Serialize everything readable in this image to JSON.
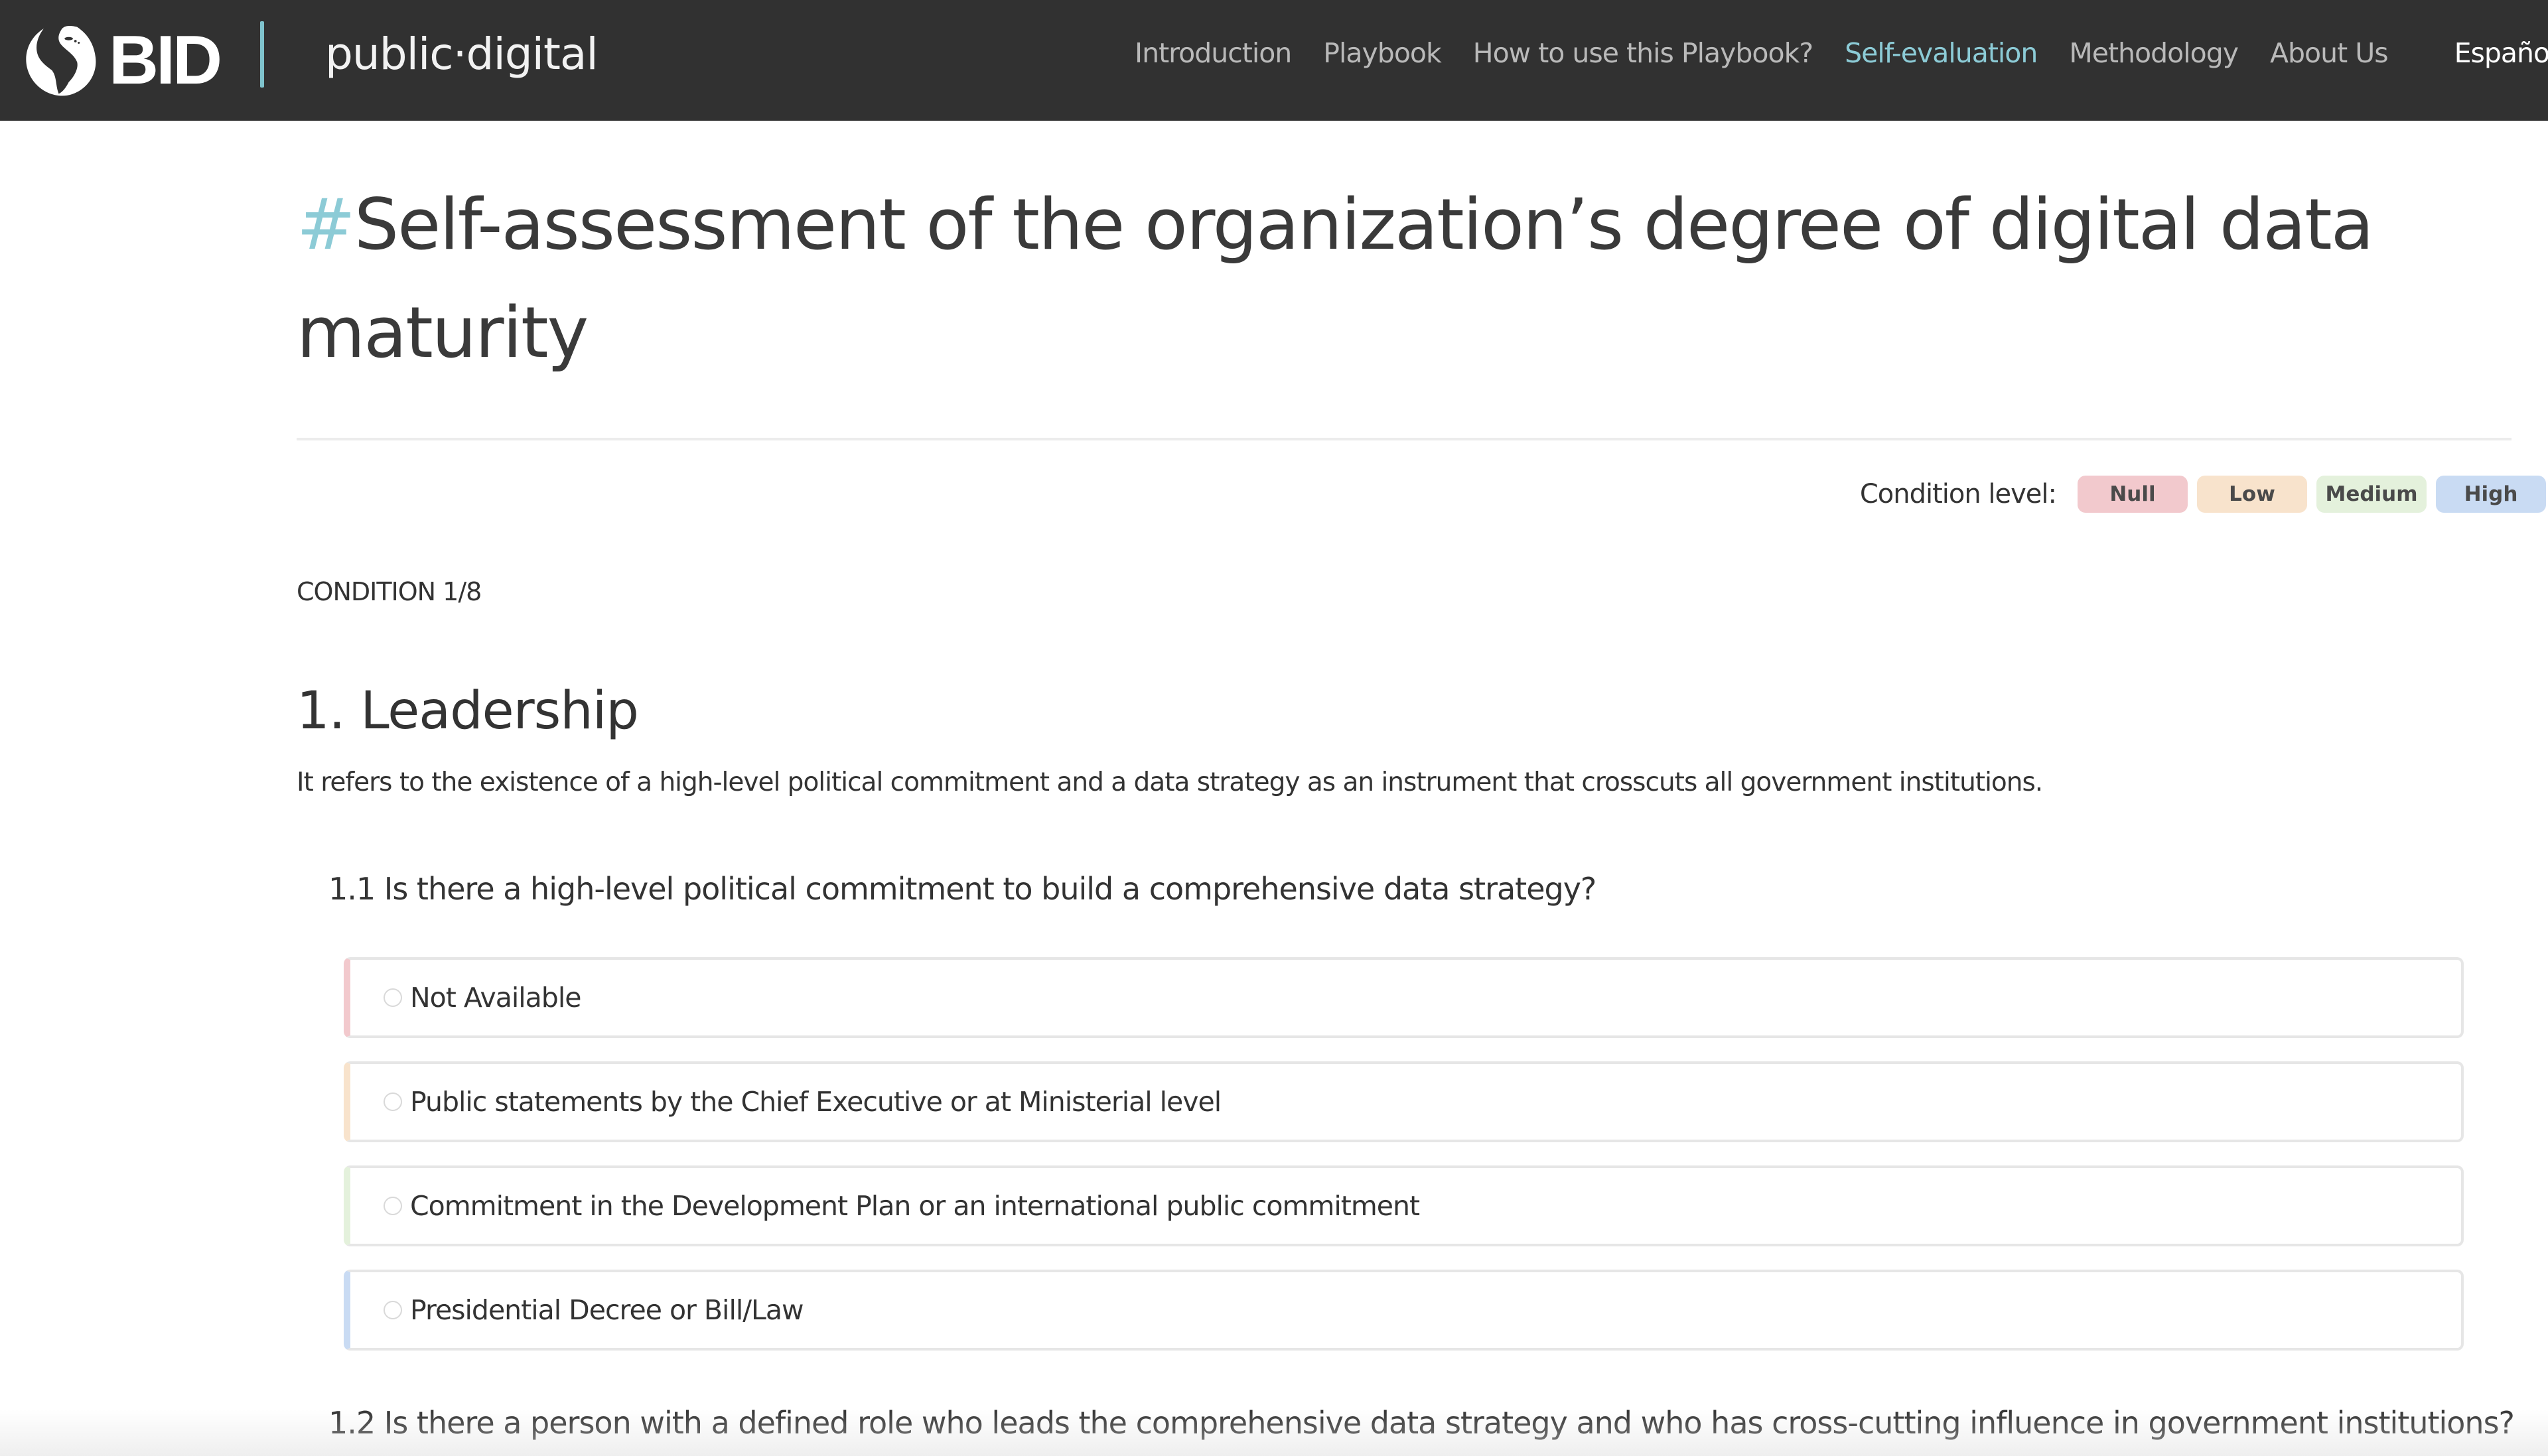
{
  "header": {
    "logo_text": "BID",
    "brand_name": "public·digital",
    "nav": [
      {
        "label": "Introduction",
        "active": false
      },
      {
        "label": "Playbook",
        "active": false
      },
      {
        "label": "How to use this Playbook?",
        "active": false
      },
      {
        "label": "Self-evaluation",
        "active": true
      },
      {
        "label": "Methodology",
        "active": false
      },
      {
        "label": "About Us",
        "active": false
      }
    ],
    "language_label": "Español",
    "colors": {
      "background": "#313131",
      "accent": "#8ccbd6"
    }
  },
  "page": {
    "title_hash": "#",
    "title": "Self-assessment of the organization’s degree of digital data maturity"
  },
  "legend": {
    "label": "Condition level:",
    "levels": [
      {
        "label": "Null",
        "color": "#f2c9cd"
      },
      {
        "label": "Low",
        "color": "#f8e3cc"
      },
      {
        "label": "Medium",
        "color": "#e4f1dc"
      },
      {
        "label": "High",
        "color": "#c9dbf3"
      }
    ]
  },
  "condition": {
    "kicker": "CONDITION 1/8",
    "title": "1. Leadership",
    "description": "It refers to the existence of a high-level political commitment and a data strategy as an instrument that crosscuts all government institutions."
  },
  "questions": [
    {
      "text": "1.1 Is there a high-level political commitment to build a comprehensive data strategy?",
      "options": [
        {
          "label": "Not Available",
          "level": "Null",
          "color": "#f2c9cd",
          "selected": false
        },
        {
          "label": "Public statements by the Chief Executive or at Ministerial level",
          "level": "Low",
          "color": "#f8e3cc",
          "selected": false
        },
        {
          "label": "Commitment in the Development Plan or an international public commitment",
          "level": "Medium",
          "color": "#e4f1dc",
          "selected": false
        },
        {
          "label": "Presidential Decree or Bill/Law",
          "level": "High",
          "color": "#c9dbf3",
          "selected": false
        }
      ]
    },
    {
      "text": "1.2 Is there a person with a defined role who leads the comprehensive data strategy and who has cross-cutting influence in government institutions?"
    }
  ]
}
